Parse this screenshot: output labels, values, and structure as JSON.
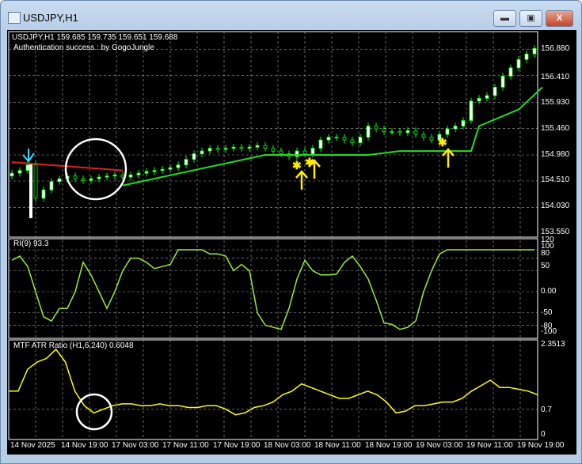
{
  "window": {
    "title": "USDJPY,H1",
    "minimize": "▬",
    "restore": "▣",
    "close": "X"
  },
  "main": {
    "header": "USDJPY,H1  159.685 159.735 159.651 159.688",
    "subtitle": "Authentication success : by GogoJungle",
    "price_ticks": [
      "156.880",
      "156.410",
      "155.930",
      "155.460",
      "154.980",
      "154.510",
      "154.030",
      "153.550"
    ]
  },
  "rsi": {
    "label": "RI(9) 93.3",
    "ticks": [
      "120",
      "100",
      "80",
      "50",
      "0.00",
      "-50",
      "-80",
      "-100"
    ]
  },
  "atr": {
    "label": "MTF ATR Ratio  (H1,6,240) 0.6048",
    "ticks": [
      "2.3513",
      "0.7",
      "0"
    ]
  },
  "time_labels": [
    "14 Nov 2025",
    "14 Nov 19:00",
    "17 Nov 03:00",
    "17 Nov 11:00",
    "17 Nov 19:00",
    "18 Nov 03:00",
    "18 Nov 11:00",
    "18 Nov 19:00",
    "19 Nov 03:00",
    "19 Nov 11:00",
    "19 Nov 19:00"
  ],
  "colors": {
    "candle": "#00ff00",
    "support": "#22dd22",
    "resistance": "#dd2222",
    "rsi": "#99ee33",
    "atr": "#ffff00",
    "arrow": "#ffee00"
  },
  "chart_data": {
    "type": "line",
    "close": [
      154.65,
      154.7,
      154.8,
      154.2,
      154.35,
      154.5,
      154.55,
      154.6,
      154.55,
      154.52,
      154.55,
      154.58,
      154.6,
      154.62,
      154.58,
      154.62,
      154.65,
      154.68,
      154.7,
      154.72,
      154.75,
      154.8,
      154.9,
      155.0,
      155.05,
      155.1,
      155.08,
      155.1,
      155.12,
      155.1,
      155.12,
      155.15,
      155.1,
      155.05,
      155.0,
      154.95,
      155.05,
      155.0,
      155.1,
      155.25,
      155.3,
      155.3,
      155.25,
      155.2,
      155.3,
      155.5,
      155.45,
      155.4,
      155.4,
      155.38,
      155.42,
      155.35,
      155.3,
      155.25,
      155.35,
      155.45,
      155.5,
      155.6,
      155.95,
      156.0,
      156.05,
      156.2,
      156.4,
      156.55,
      156.7,
      156.8,
      156.9
    ],
    "support": [
      [
        14,
        154.43
      ],
      [
        32,
        154.98
      ],
      [
        45,
        154.98
      ],
      [
        49,
        155.05
      ],
      [
        58,
        155.05
      ],
      [
        59,
        155.5
      ],
      [
        64,
        155.8
      ],
      [
        67,
        156.2
      ]
    ],
    "resistance": [
      [
        0,
        154.85
      ],
      [
        14,
        154.7
      ]
    ],
    "rsi": [
      75,
      85,
      60,
      0,
      -60,
      -70,
      -40,
      -40,
      0,
      70,
      40,
      0,
      -40,
      0,
      50,
      80,
      80,
      70,
      55,
      60,
      65,
      100,
      100,
      100,
      100,
      90,
      90,
      85,
      50,
      65,
      50,
      -50,
      -80,
      -85,
      -90,
      -40,
      30,
      75,
      50,
      40,
      40,
      42,
      70,
      85,
      60,
      30,
      -20,
      -75,
      -78,
      -90,
      -85,
      -70,
      0,
      50,
      90,
      100,
      100,
      100,
      100,
      100,
      100,
      100,
      100,
      100,
      100,
      100,
      100
    ],
    "atr": [
      1.2,
      1.2,
      1.8,
      2.0,
      2.1,
      2.35,
      2.0,
      1.2,
      0.8,
      0.6,
      0.7,
      0.8,
      0.85,
      0.85,
      0.8,
      0.8,
      0.85,
      0.8,
      0.8,
      0.75,
      0.75,
      0.8,
      0.8,
      0.7,
      0.55,
      0.6,
      0.75,
      0.8,
      0.9,
      1.1,
      1.2,
      1.4,
      1.3,
      1.2,
      1.1,
      1.0,
      1.0,
      1.1,
      1.2,
      1.1,
      0.9,
      0.6,
      0.65,
      0.8,
      0.8,
      0.85,
      0.9,
      0.9,
      1.0,
      1.2,
      1.35,
      1.5,
      1.3,
      1.3,
      1.25,
      1.2,
      1.1
    ],
    "price_range": [
      153.55,
      156.88
    ],
    "rsi_range": [
      -100,
      120
    ],
    "atr_range": [
      0,
      2.3513
    ]
  }
}
